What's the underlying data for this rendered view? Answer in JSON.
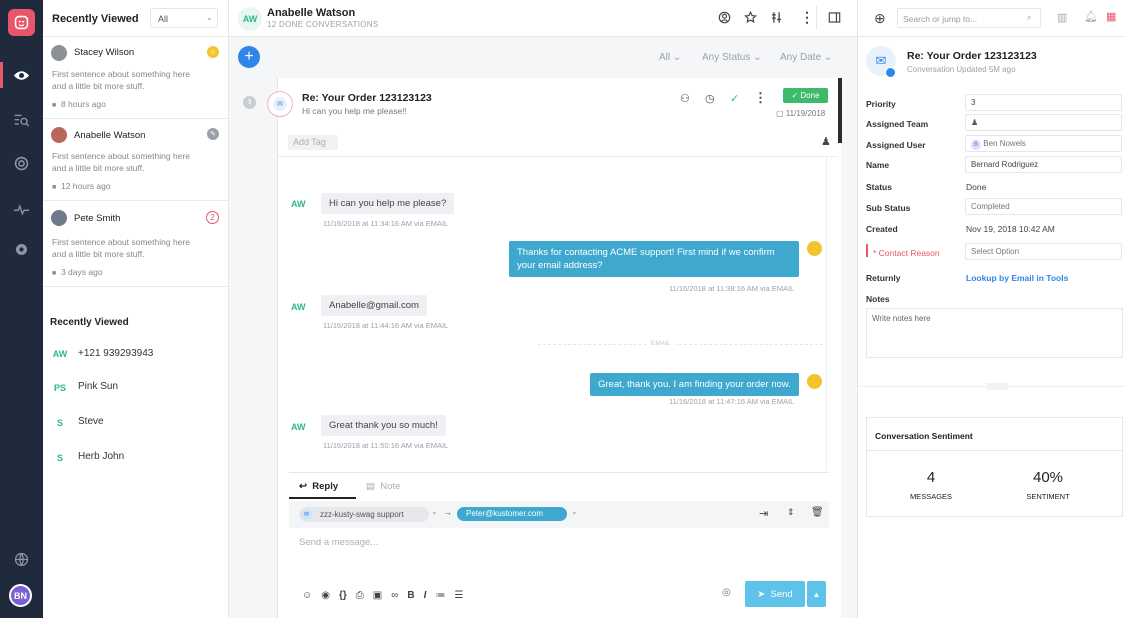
{
  "rail": {
    "user_initials": "BN",
    "accent": "#e8566c",
    "background": "#1f2a3c"
  },
  "list": {
    "title": "Recently Viewed",
    "filter": "All",
    "conversations": [
      {
        "name": "Stacey Wilson",
        "preview_line1": "First sentence about something here",
        "preview_line2": "and a little bit more stuff.",
        "time": "8 hours ago"
      },
      {
        "name": "Anabelle Watson",
        "preview_line1": "First sentence about something here",
        "preview_line2": "and a little bit more stuff.",
        "time": "12 hours ago"
      },
      {
        "name": "Pete Smith",
        "preview_line1": "First sentence about something here",
        "preview_line2": "and a little bit more stuff.",
        "time": "3 days ago",
        "badge": "2"
      }
    ],
    "recent_title": "Recently Viewed",
    "recent": [
      {
        "initials": "AW",
        "label": "+121 939293943"
      },
      {
        "initials": "PS",
        "label": "Pink Sun"
      },
      {
        "initials": "S",
        "label": "Steve"
      },
      {
        "initials": "S",
        "label": "Herb John"
      }
    ]
  },
  "header": {
    "initials": "AW",
    "name": "Anabelle Watson",
    "sub": "12 DONE CONVERSATIONS"
  },
  "filters": {
    "all": "All",
    "status": "Any Status",
    "date": "Any Date"
  },
  "conversation": {
    "count": "3",
    "title": "Re: Your Order 123123123",
    "preview": "Hi can you help me please!!",
    "status": "Done",
    "date": "11/19/2018",
    "add_tag": "Add Tag"
  },
  "messages": [
    {
      "dir": "in",
      "initials": "AW",
      "text": "Hi can you help me please?",
      "meta": "11/16/2018 at 11:34:16 AM via EMAIL"
    },
    {
      "dir": "out",
      "text": "Thanks for contacting ACME support! First mind if we confirm your email address?",
      "meta": "11/16/2018 at 11:38:16 AM via EMAIL"
    },
    {
      "dir": "in",
      "initials": "AW",
      "text": "Anabelle@gmail.com",
      "meta": "11/16/2018 at 11:44:16 AM via EMAIL"
    },
    {
      "dir": "out",
      "text": "Great, thank you. I am finding your order now.",
      "meta": "11/16/2018 at 11:47:16 AM via EMAIL"
    },
    {
      "dir": "in",
      "initials": "AW",
      "text": "Great thank you so much!",
      "meta": "11/16/2018 at 11:50:16 AM via EMAIL"
    }
  ],
  "divider_label": "EMAIL",
  "composer": {
    "tab_reply": "Reply",
    "tab_note": "Note",
    "from": "zzz-kusty-swag support",
    "to": "Peter@kustomer.com",
    "placeholder": "Send a message...",
    "send": "Send"
  },
  "top": {
    "search_placeholder": "Search or jump to..."
  },
  "details": {
    "title": "Re: Your Order 123123123",
    "sub": "Conversation Updated 5M ago",
    "fields": {
      "priority_label": "Priority",
      "priority": "3",
      "team_label": "Assigned Team",
      "user_label": "Assigned User",
      "user": "Ben Nowels",
      "name_label": "Name",
      "name": "Bernard Rodriguez",
      "status_label": "Status",
      "status": "Done",
      "substatus_label": "Sub Status",
      "substatus": "Completed",
      "created_label": "Created",
      "created": "Nov 19, 2018 10:42 AM",
      "reason_label": "* Contact Reason",
      "reason_placeholder": "Select Option",
      "returnly_label": "Returnly",
      "returnly": "Lookup by Email in Tools",
      "notes_label": "Notes",
      "notes_placeholder": "Write notes here"
    },
    "sentiment": {
      "title": "Conversation Sentiment",
      "messages_value": "4",
      "messages_label": "MESSAGES",
      "sentiment_value": "40%",
      "sentiment_label": "SENTIMENT"
    }
  }
}
